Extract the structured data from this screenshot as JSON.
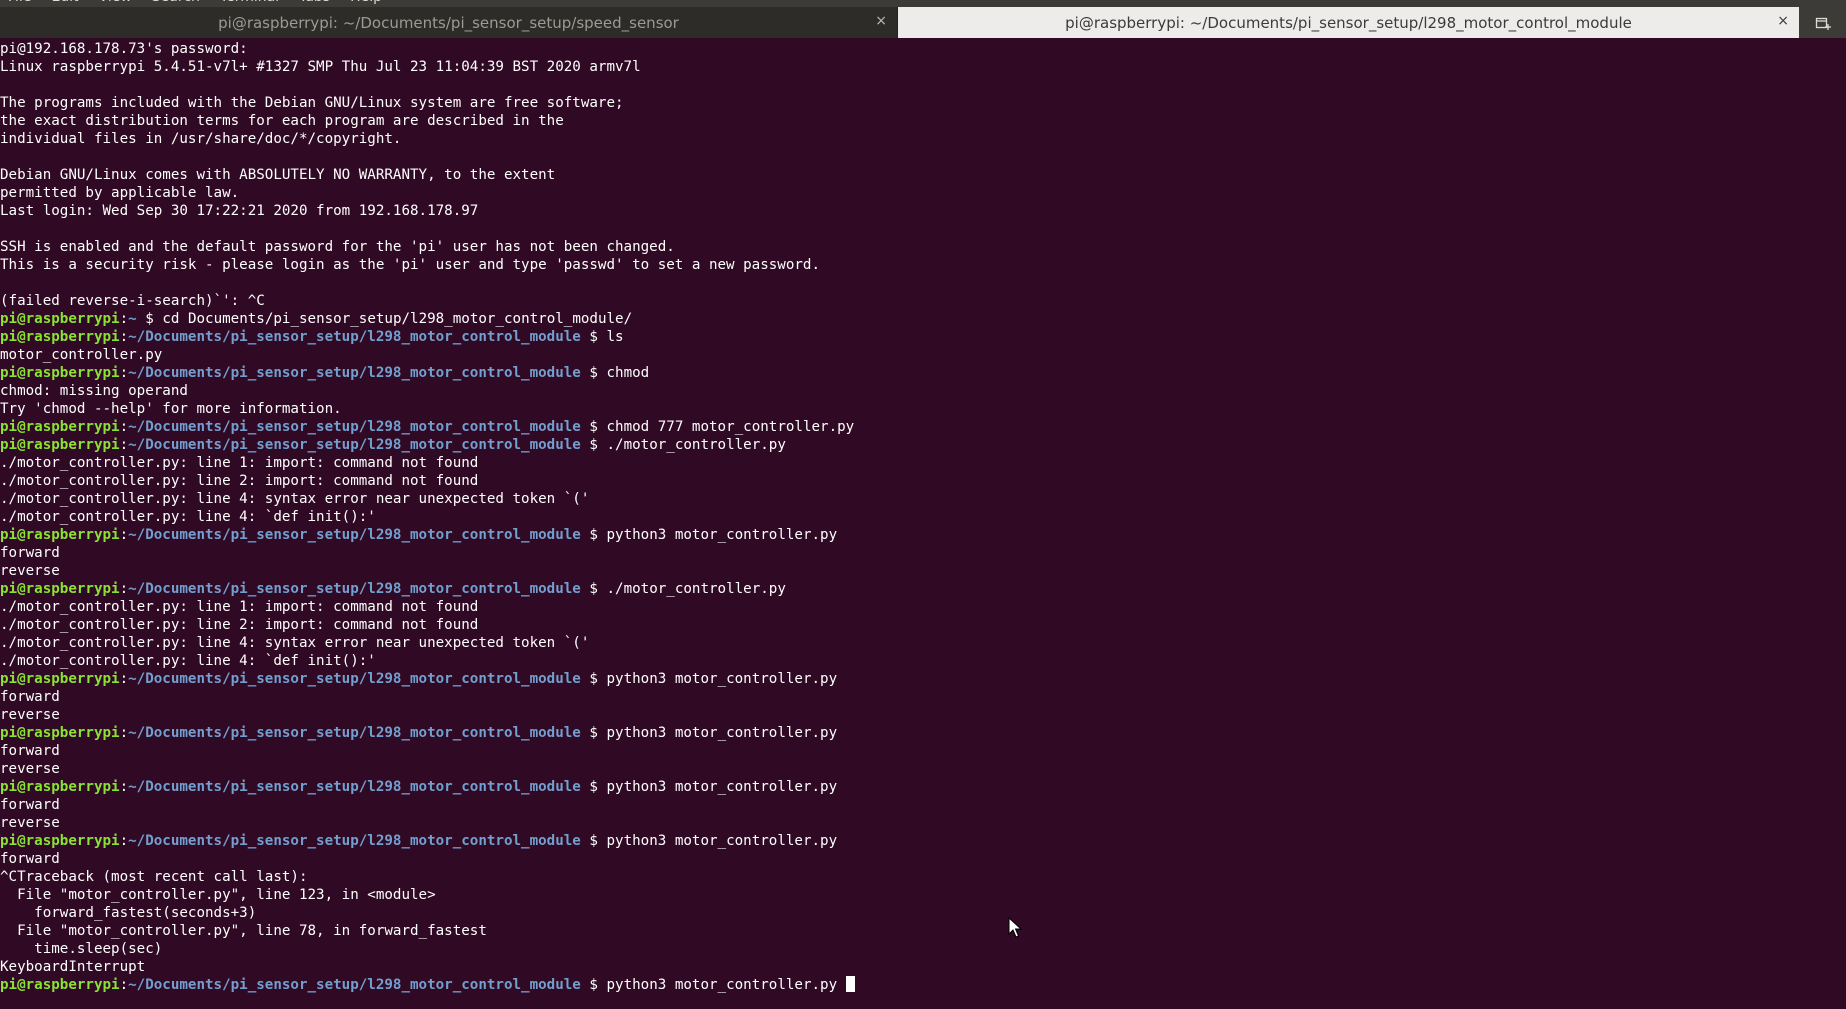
{
  "menubar": [
    "File",
    "Edit",
    "View",
    "Search",
    "Terminal",
    "Tabs",
    "Help"
  ],
  "tabs": [
    {
      "title": "pi@raspberrypi: ~/Documents/pi_sensor_setup/speed_sensor",
      "close": "×",
      "active": false
    },
    {
      "title": "pi@raspberrypi: ~/Documents/pi_sensor_setup/l298_motor_control_module",
      "close": "×",
      "active": true
    }
  ],
  "colors": {
    "background": "#300a24",
    "prompt_user": "#8ae234",
    "prompt_dir": "#729fcf",
    "text": "#ffffff"
  },
  "icons": {
    "new_tab": "new-tab-icon",
    "mouse": "mouse-pointer-icon"
  },
  "prompt": {
    "user": "pi@raspberrypi",
    "home": "~",
    "dir": "~/Documents/pi_sensor_setup/l298_motor_control_module",
    "symbol": "$"
  },
  "lines": [
    {
      "t": "out",
      "text": "pi@192.168.178.73's password:"
    },
    {
      "t": "out",
      "text": "Linux raspberrypi 5.4.51-v7l+ #1327 SMP Thu Jul 23 11:04:39 BST 2020 armv7l"
    },
    {
      "t": "out",
      "text": ""
    },
    {
      "t": "out",
      "text": "The programs included with the Debian GNU/Linux system are free software;"
    },
    {
      "t": "out",
      "text": "the exact distribution terms for each program are described in the"
    },
    {
      "t": "out",
      "text": "individual files in /usr/share/doc/*/copyright."
    },
    {
      "t": "out",
      "text": ""
    },
    {
      "t": "out",
      "text": "Debian GNU/Linux comes with ABSOLUTELY NO WARRANTY, to the extent"
    },
    {
      "t": "out",
      "text": "permitted by applicable law."
    },
    {
      "t": "out",
      "text": "Last login: Wed Sep 30 17:22:21 2020 from 192.168.178.97"
    },
    {
      "t": "out",
      "text": ""
    },
    {
      "t": "out",
      "text": "SSH is enabled and the default password for the 'pi' user has not been changed."
    },
    {
      "t": "out",
      "text": "This is a security risk - please login as the 'pi' user and type 'passwd' to set a new password."
    },
    {
      "t": "out",
      "text": ""
    },
    {
      "t": "out",
      "text": "(failed reverse-i-search)`': ^C"
    },
    {
      "t": "cmd",
      "dir": "~",
      "text": "cd Documents/pi_sensor_setup/l298_motor_control_module/"
    },
    {
      "t": "cmd",
      "dir": "~/Documents/pi_sensor_setup/l298_motor_control_module",
      "text": "ls"
    },
    {
      "t": "out",
      "text": "motor_controller.py"
    },
    {
      "t": "cmd",
      "dir": "~/Documents/pi_sensor_setup/l298_motor_control_module",
      "text": "chmod"
    },
    {
      "t": "out",
      "text": "chmod: missing operand"
    },
    {
      "t": "out",
      "text": "Try 'chmod --help' for more information."
    },
    {
      "t": "cmd",
      "dir": "~/Documents/pi_sensor_setup/l298_motor_control_module",
      "text": "chmod 777 motor_controller.py"
    },
    {
      "t": "cmd",
      "dir": "~/Documents/pi_sensor_setup/l298_motor_control_module",
      "text": "./motor_controller.py"
    },
    {
      "t": "out",
      "text": "./motor_controller.py: line 1: import: command not found"
    },
    {
      "t": "out",
      "text": "./motor_controller.py: line 2: import: command not found"
    },
    {
      "t": "out",
      "text": "./motor_controller.py: line 4: syntax error near unexpected token `('"
    },
    {
      "t": "out",
      "text": "./motor_controller.py: line 4: `def init():'"
    },
    {
      "t": "cmd",
      "dir": "~/Documents/pi_sensor_setup/l298_motor_control_module",
      "text": "python3 motor_controller.py"
    },
    {
      "t": "out",
      "text": "forward"
    },
    {
      "t": "out",
      "text": "reverse"
    },
    {
      "t": "cmd",
      "dir": "~/Documents/pi_sensor_setup/l298_motor_control_module",
      "text": "./motor_controller.py"
    },
    {
      "t": "out",
      "text": "./motor_controller.py: line 1: import: command not found"
    },
    {
      "t": "out",
      "text": "./motor_controller.py: line 2: import: command not found"
    },
    {
      "t": "out",
      "text": "./motor_controller.py: line 4: syntax error near unexpected token `('"
    },
    {
      "t": "out",
      "text": "./motor_controller.py: line 4: `def init():'"
    },
    {
      "t": "cmd",
      "dir": "~/Documents/pi_sensor_setup/l298_motor_control_module",
      "text": "python3 motor_controller.py"
    },
    {
      "t": "out",
      "text": "forward"
    },
    {
      "t": "out",
      "text": "reverse"
    },
    {
      "t": "cmd",
      "dir": "~/Documents/pi_sensor_setup/l298_motor_control_module",
      "text": "python3 motor_controller.py"
    },
    {
      "t": "out",
      "text": "forward"
    },
    {
      "t": "out",
      "text": "reverse"
    },
    {
      "t": "cmd",
      "dir": "~/Documents/pi_sensor_setup/l298_motor_control_module",
      "text": "python3 motor_controller.py"
    },
    {
      "t": "out",
      "text": "forward"
    },
    {
      "t": "out",
      "text": "reverse"
    },
    {
      "t": "cmd",
      "dir": "~/Documents/pi_sensor_setup/l298_motor_control_module",
      "text": "python3 motor_controller.py"
    },
    {
      "t": "out",
      "text": "forward"
    },
    {
      "t": "out",
      "text": "^CTraceback (most recent call last):"
    },
    {
      "t": "out",
      "text": "  File \"motor_controller.py\", line 123, in <module>"
    },
    {
      "t": "out",
      "text": "    forward_fastest(seconds+3)"
    },
    {
      "t": "out",
      "text": "  File \"motor_controller.py\", line 78, in forward_fastest"
    },
    {
      "t": "out",
      "text": "    time.sleep(sec)"
    },
    {
      "t": "out",
      "text": "KeyboardInterrupt"
    },
    {
      "t": "cmd",
      "dir": "~/Documents/pi_sensor_setup/l298_motor_control_module",
      "text": "python3 motor_controller.py",
      "cursor": true
    }
  ]
}
